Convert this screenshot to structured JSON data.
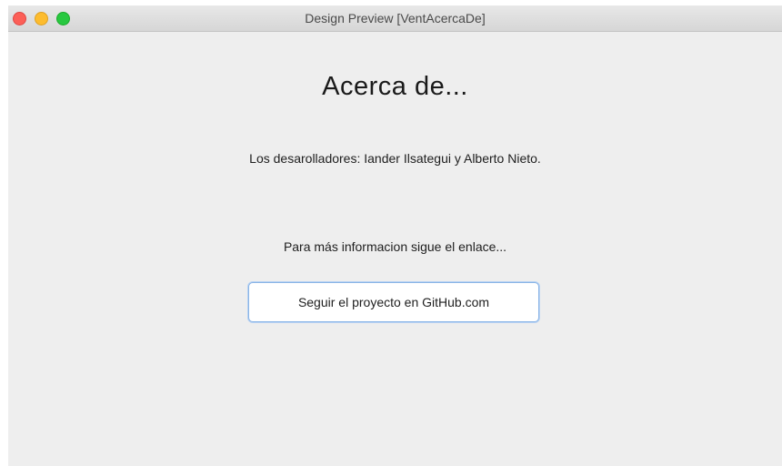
{
  "window": {
    "title": "Design Preview [VentAcercaDe]"
  },
  "content": {
    "heading": "Acerca de...",
    "developers_text": "Los desarolladores: Iander Ilsategui y Alberto Nieto.",
    "info_text": "Para más informacion sigue el enlace...",
    "github_button_label": "Seguir el proyecto en GitHub.com"
  }
}
